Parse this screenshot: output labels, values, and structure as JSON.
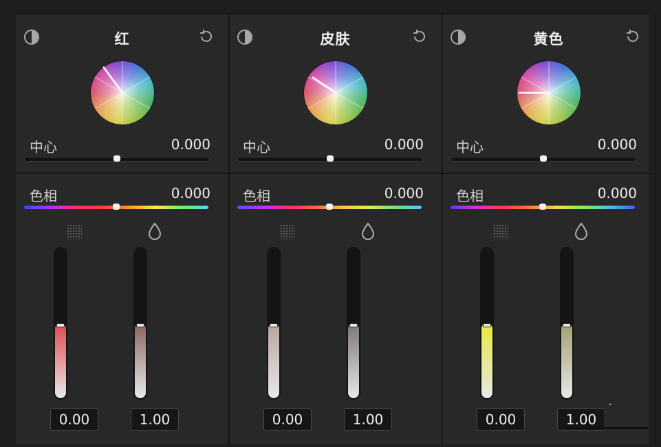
{
  "panels": [
    {
      "title": "红",
      "center_label": "中心",
      "center_value": "0.000",
      "center_position": 0.5,
      "hue_label": "色相",
      "hue_value": "0.000",
      "hue_position": 0.5,
      "saturation_value": "0.00",
      "saturation_level": 0.5,
      "saturation_color": "#e0484c",
      "luminance_value": "1.00",
      "luminance_level": 0.5,
      "luminance_color": "#8a6462",
      "wheel_pointer_angle_deg": 215
    },
    {
      "title": "皮肤",
      "center_label": "中心",
      "center_value": "0.000",
      "center_position": 0.5,
      "hue_label": "色相",
      "hue_value": "0.000",
      "hue_position": 0.5,
      "saturation_value": "0.00",
      "saturation_level": 0.5,
      "saturation_color": "#b7a69e",
      "luminance_value": "1.00",
      "luminance_level": 0.5,
      "luminance_color": "#7c7674",
      "wheel_pointer_angle_deg": 200
    },
    {
      "title": "黄色",
      "center_label": "中心",
      "center_value": "0.000",
      "center_position": 0.5,
      "hue_label": "色相",
      "hue_value": "0.000",
      "hue_position": 0.5,
      "saturation_value": "0.00",
      "saturation_level": 0.5,
      "saturation_color": "#e8e83a",
      "luminance_value": "1.00",
      "luminance_level": 0.5,
      "luminance_color": "#a0a070",
      "wheel_pointer_angle_deg": 180
    }
  ],
  "icons": {
    "contrast": "contrast-icon",
    "reset": "reset-icon",
    "grid": "grid-icon",
    "drop": "droplet-icon"
  }
}
